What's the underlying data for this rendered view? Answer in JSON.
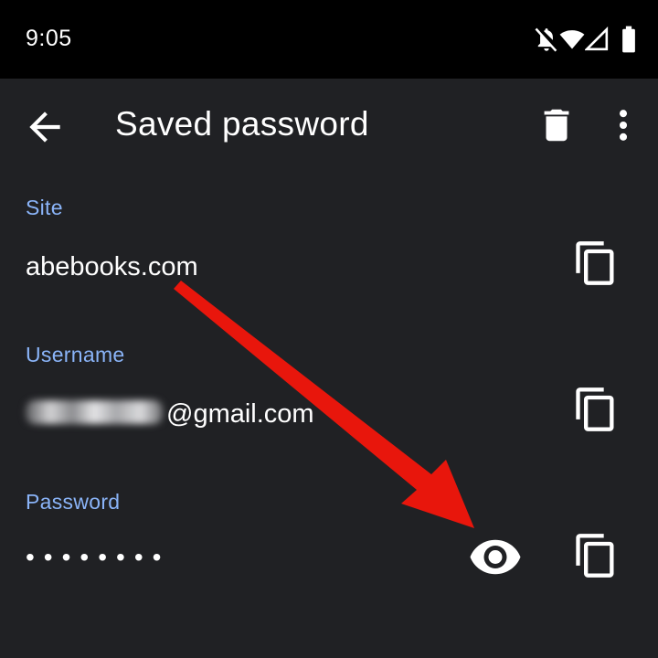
{
  "status_bar": {
    "time": "9:05",
    "icons": [
      "notifications-off-icon",
      "wifi-icon",
      "cellular-signal-icon",
      "battery-icon"
    ]
  },
  "app_bar": {
    "title": "Saved password",
    "icons": [
      "back-arrow-icon",
      "delete-icon",
      "more-vert-icon"
    ]
  },
  "fields": {
    "site": {
      "label": "Site",
      "value": "abebooks.com"
    },
    "username": {
      "label": "Username",
      "value_visible": "@gmail.com"
    },
    "password": {
      "label": "Password",
      "masked_value": "••••••••"
    }
  },
  "colors": {
    "background": "#202124",
    "status_bar": "#000000",
    "label_accent": "#8ab4f8",
    "text": "#ffffff",
    "annotation_arrow": "#e8160c"
  }
}
